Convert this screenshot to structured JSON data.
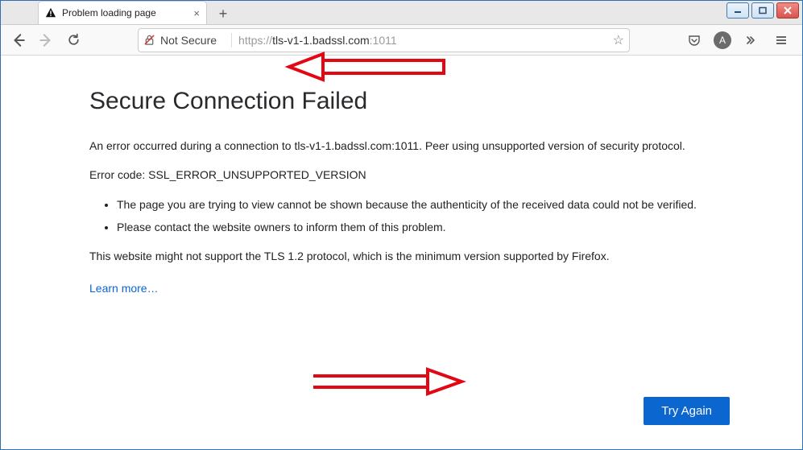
{
  "window": {
    "minimize_title": "Minimize",
    "maximize_title": "Maximize",
    "close_title": "Close"
  },
  "tab": {
    "title": "Problem loading page",
    "close_label": "×",
    "newtab_label": "+"
  },
  "toolbar": {
    "back_title": "Back",
    "forward_title": "Forward",
    "reload_title": "Reload",
    "lock_title": "Not Secure",
    "secure_label": "Not Secure",
    "url_scheme": "https://",
    "url_host": "tls-v1-1.badssl.com",
    "url_port": ":1011",
    "star_title": "Bookmark",
    "pocket_title": "Save to Pocket",
    "avatar_letter": "A",
    "overflow_title": "More tools",
    "menu_title": "Menu"
  },
  "error": {
    "title": "Secure Connection Failed",
    "p1": "An error occurred during a connection to tls-v1-1.badssl.com:1011. Peer using unsupported version of security protocol.",
    "p2": "Error code: SSL_ERROR_UNSUPPORTED_VERSION",
    "li1": "The page you are trying to view cannot be shown because the authenticity of the received data could not be verified.",
    "li2": "Please contact the website owners to inform them of this problem.",
    "p3": "This website might not support the TLS 1.2 protocol, which is the minimum version supported by Firefox.",
    "learn_more": "Learn more…",
    "try_again": "Try Again"
  }
}
